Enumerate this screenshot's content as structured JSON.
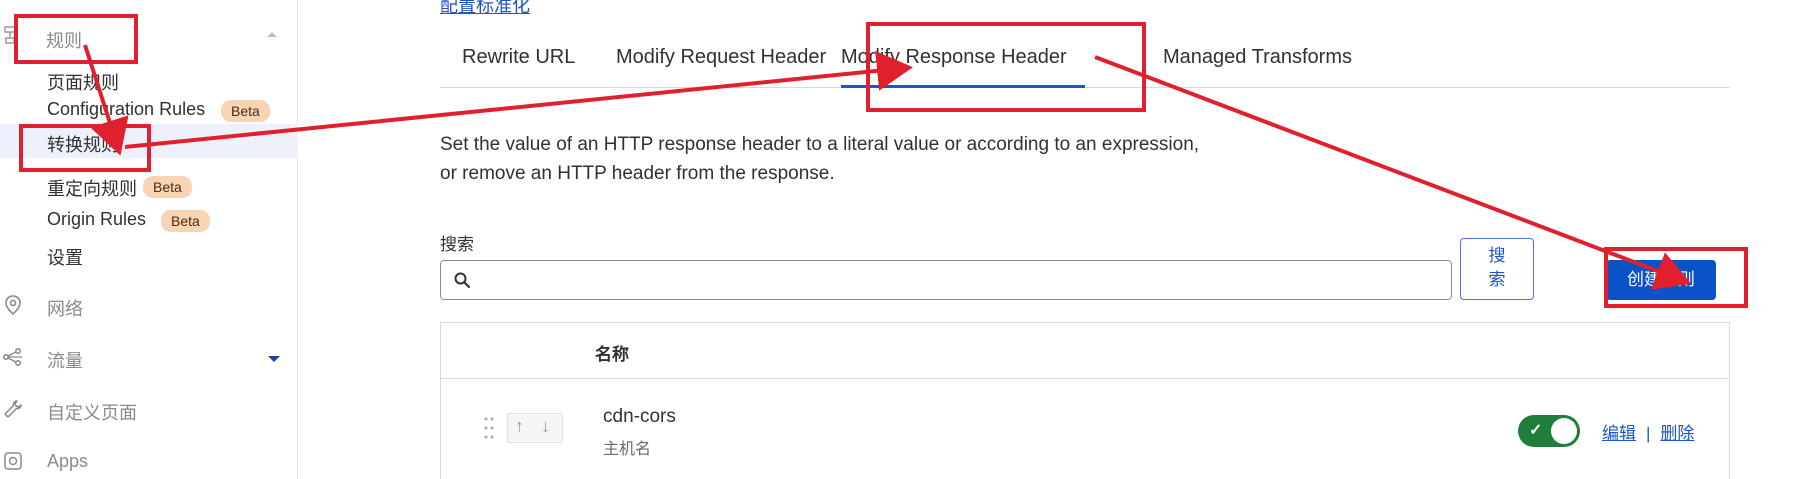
{
  "sidebar": {
    "section_label": "规则",
    "subitems": [
      {
        "label": "页面规则",
        "badge": ""
      },
      {
        "label": "Configuration Rules",
        "badge": "Beta"
      },
      {
        "label": "转换规则",
        "badge": ""
      },
      {
        "label": "重定向规则",
        "badge": "Beta"
      },
      {
        "label": "Origin Rules",
        "badge": "Beta"
      },
      {
        "label": "设置",
        "badge": ""
      }
    ],
    "items": [
      {
        "label": "网络",
        "icon": "location-pin-icon"
      },
      {
        "label": "流量",
        "icon": "traffic-share-icon"
      },
      {
        "label": "自定义页面",
        "icon": "wrench-icon"
      },
      {
        "label": "Apps",
        "icon": "apps-icon"
      }
    ]
  },
  "main": {
    "top_link": "配置标准化",
    "tabs": [
      {
        "label": "Rewrite URL"
      },
      {
        "label": "Modify Request Header"
      },
      {
        "label": "Modify Response Header"
      },
      {
        "label": "Managed Transforms"
      }
    ],
    "description": "Set the value of an HTTP response header to a literal value or according to an expression, or remove an HTTP header from the response.",
    "search": {
      "label": "搜索",
      "value": "",
      "button_label": "搜索"
    },
    "create_button": "创建规则",
    "table": {
      "header": "名称",
      "rows": [
        {
          "name": "cdn-cors",
          "subtitle": "主机名",
          "enabled": true,
          "edit": "编辑",
          "separator": "|",
          "delete": "删除"
        }
      ]
    }
  },
  "colors": {
    "accent": "#1f55c9",
    "primary_button": "#0a52c7",
    "toggle_on": "#1f7f3a",
    "badge_bg": "#f7d4b4",
    "annotation_red": "#e0202e"
  }
}
